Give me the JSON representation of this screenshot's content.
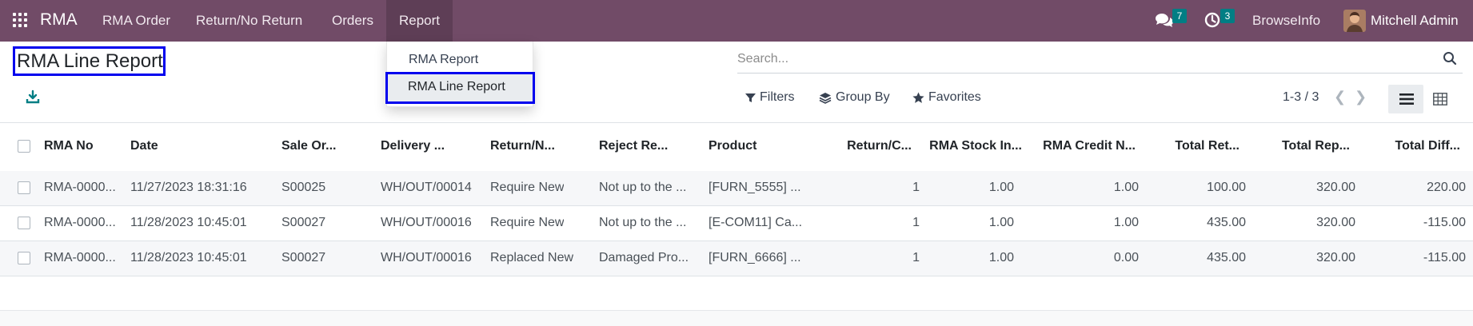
{
  "navbar": {
    "app_name": "RMA",
    "menu": [
      "RMA Order",
      "Return/No Return",
      "Orders",
      "Report"
    ],
    "messages_count": "7",
    "activities_count": "3",
    "company": "BrowseInfo",
    "user": "Mitchell Admin",
    "color": "#714b67"
  },
  "page": {
    "title": "RMA Line Report"
  },
  "report_menu": {
    "items": [
      "RMA Report",
      "RMA Line Report"
    ],
    "highlighted": "RMA Line Report"
  },
  "search": {
    "placeholder": "Search..."
  },
  "filters": {
    "filters_label": "Filters",
    "groupby_label": "Group By",
    "favorites_label": "Favorites"
  },
  "pager": {
    "value": "1-3 / 3"
  },
  "table": {
    "columns": [
      "RMA No",
      "Date",
      "Sale Or...",
      "Delivery ...",
      "Return/N...",
      "Reject Re...",
      "Product",
      "Return/C...",
      "RMA Stock In...",
      "RMA Credit N...",
      "Total Ret...",
      "Total Rep...",
      "Total Diff..."
    ],
    "rows": [
      [
        "RMA-0000...",
        "11/27/2023 18:31:16",
        "S00025",
        "WH/OUT/00014",
        "Require New",
        "Not up to the ...",
        "[FURN_5555] ...",
        "1",
        "1.00",
        "1.00",
        "100.00",
        "320.00",
        "220.00"
      ],
      [
        "RMA-0000...",
        "11/28/2023 10:45:01",
        "S00027",
        "WH/OUT/00016",
        "Require New",
        "Not up to the ...",
        "[E-COM11] Ca...",
        "1",
        "1.00",
        "1.00",
        "435.00",
        "320.00",
        "-115.00"
      ],
      [
        "RMA-0000...",
        "11/28/2023 10:45:01",
        "S00027",
        "WH/OUT/00016",
        "Replaced New",
        "Damaged Pro...",
        "[FURN_6666] ...",
        "1",
        "1.00",
        "0.00",
        "435.00",
        "320.00",
        "-115.00"
      ]
    ]
  }
}
